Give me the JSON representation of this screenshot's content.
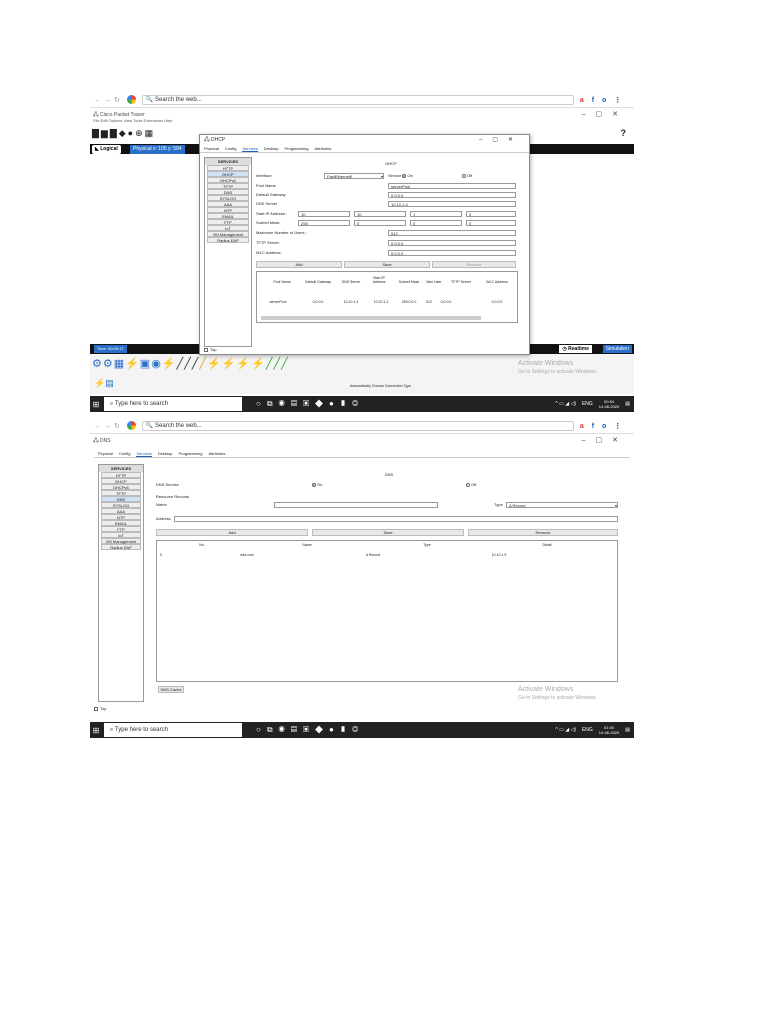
{
  "browser": {
    "search_placeholder": "Search the web...",
    "ext_a": "a",
    "ext_f": "f",
    "ext_o": "o"
  },
  "shot1": {
    "window_title": "Cisco Packet Tracer",
    "menu": "File   Edit   Options   View   Tools   Extensions   Help",
    "logical_tab": "Logical",
    "physical_tab": "Physical",
    "coords": "x: 105 y: 584",
    "time": "Time: 00:09:17",
    "realtime": "Realtime",
    "simulation": "Simulation",
    "auto_conn": "Automatically Choose Connection Type",
    "dialog": {
      "title": "DHCP",
      "tabs": [
        "Physical",
        "Config",
        "Services",
        "Desktop",
        "Programming",
        "Attributes"
      ],
      "services_head": "SERVICES",
      "services": [
        "HTTP",
        "DHCP",
        "DHCPv6",
        "TFTP",
        "DNS",
        "SYSLOG",
        "AAA",
        "NTP",
        "EMAIL",
        "FTP",
        "IoT",
        "VM Management",
        "Radius EAP"
      ],
      "panel_title": "DHCP",
      "interface_label": "Interface",
      "interface_value": "FastEthernet0",
      "service_label": "Service",
      "on": "On",
      "off": "Off",
      "pool_name_label": "Pool Name",
      "pool_name_value": "serverPool",
      "gateway_label": "Default Gateway",
      "gateway_value": "0.0.0.0",
      "dns_label": "DNS Server",
      "dns_value": "10.10.1.4",
      "start_ip_label": "Start IP Address :",
      "start_ip": [
        "10",
        "10",
        "1",
        "0"
      ],
      "mask_label": "Subnet Mask:",
      "mask": [
        "255",
        "0",
        "0",
        "0"
      ],
      "max_users_label": "Maximum Number of Users :",
      "max_users_value": "512",
      "tftp_label": "TFTP Server:",
      "tftp_value": "0.0.0.0",
      "wlc_label": "WLC Address:",
      "wlc_value": "0.0.0.0",
      "btn_add": "Add",
      "btn_save": "Save",
      "btn_remove": "Remove",
      "table_headers": [
        "Pool Name",
        "Default Gateway",
        "DNS Server",
        "Start IP Address",
        "Subnet Mask",
        "Max User",
        "TFTP Server",
        "WLC Address"
      ],
      "table_row": [
        "serverPool",
        "0.0.0.0",
        "10.10.1.4",
        "10.10.1.2",
        "255.0.0.0",
        "512",
        "0.0.0.0",
        "0.0.0.0"
      ],
      "top_checkbox": "Top"
    },
    "activate_title": "Activate Windows",
    "activate_sub": "Go to Settings to activate Windows.",
    "taskbar_search": "Type here to search",
    "tray_lang": "ENG",
    "clock_time": "00:54",
    "clock_date": "14-06-2020"
  },
  "shot2": {
    "window_title": "DNS",
    "tabs": [
      "Physical",
      "Config",
      "Services",
      "Desktop",
      "Programming",
      "Attributes"
    ],
    "services_head": "SERVICES",
    "services": [
      "HTTP",
      "DHCP",
      "DHCPv6",
      "TFTP",
      "DNS",
      "SYSLOG",
      "AAA",
      "NTP",
      "EMAIL",
      "FTP",
      "IoT",
      "VM Management",
      "Radius EAP"
    ],
    "panel_title": "DNS",
    "dns_service_label": "DNS Service",
    "on": "On",
    "off": "Off",
    "rr_label": "Resource Records",
    "name_label": "Name",
    "type_label": "Type",
    "type_value": "A Record",
    "address_label": "Address",
    "btn_add": "Add",
    "btn_save": "Save",
    "btn_remove": "Remove",
    "table_headers": [
      "No.",
      "Name",
      "Type",
      "Detail"
    ],
    "table_row": [
      "0",
      "rtad.com",
      "A Record",
      "10.10.1.5"
    ],
    "dns_cache_btn": "DNS Cache",
    "top_checkbox": "Top",
    "activate_title": "Activate Windows",
    "activate_sub": "Go to Settings to activate Windows.",
    "taskbar_search": "Type here to search",
    "tray_lang": "ENG",
    "clock_time": "01:00",
    "clock_date": "14-06-2020"
  }
}
